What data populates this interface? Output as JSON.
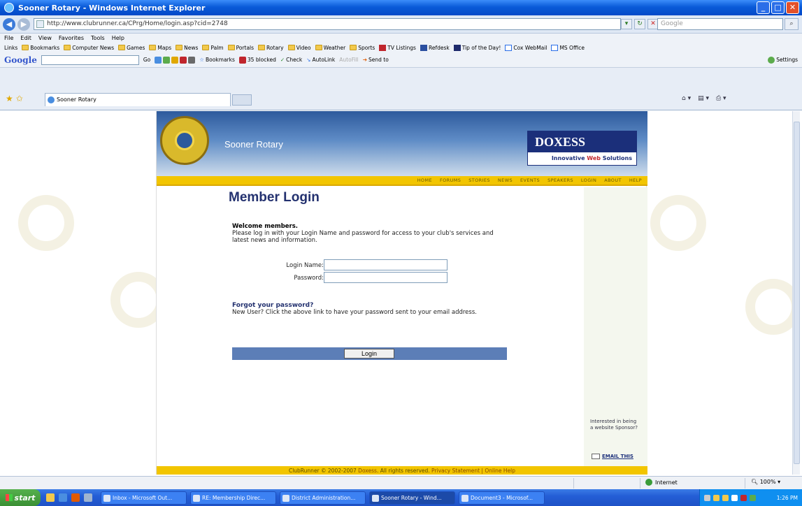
{
  "window": {
    "title": "Sooner Rotary - Windows Internet Explorer"
  },
  "address": {
    "url": "http://www.clubrunner.ca/CPrg/Home/login.asp?cid=2748",
    "search_placeholder": "Google"
  },
  "menu": [
    "File",
    "Edit",
    "View",
    "Favorites",
    "Tools",
    "Help"
  ],
  "links": {
    "label": "Links",
    "items": [
      "Bookmarks",
      "Computer News",
      "Games",
      "Maps",
      "News",
      "Palm",
      "Portals",
      "Rotary",
      "Video",
      "Weather",
      "Sports",
      "TV Listings",
      "Refdesk",
      "Tip of the Day!",
      "Cox WebMail",
      "MS Office"
    ]
  },
  "google": {
    "logo": "Google",
    "go": "Go",
    "bookmarks": "Bookmarks",
    "blocked": "35 blocked",
    "check": "Check",
    "autolink": "AutoLink",
    "autofill": "AutoFill",
    "sendto": "Send to",
    "settings": "Settings"
  },
  "tab": {
    "label": "Sooner Rotary"
  },
  "site": {
    "name": "Sooner Rotary",
    "vendor_logo": "DOXESS",
    "vendor_tag_a": "Innovative ",
    "vendor_tag_b": "Web",
    "vendor_tag_c": " Solutions",
    "nav": [
      "HOME",
      "FORUMS",
      "STORIES",
      "NEWS",
      "EVENTS",
      "SPEAKERS",
      "LOGIN",
      "ABOUT",
      "HELP"
    ],
    "heading": "Member Login",
    "welcome": "Welcome members.",
    "intro": "Please log in with your Login Name and password for access to your club's services and latest news and information.",
    "login_label": "Login Name:",
    "password_label": "Password:",
    "forgot": "Forgot your password?",
    "new_user": "New User? Click the above link to have your password sent to your email address.",
    "login_button": "Login",
    "sponsor": "Interested in being a website Sponsor?",
    "email_this": "EMAIL THIS",
    "footer_a": "ClubRunner © 2002-2007 ",
    "footer_b": "Doxess",
    "footer_c": ". All rights reserved. ",
    "footer_d": "Privacy Statement | Online Help"
  },
  "status": {
    "zone": "Internet",
    "zoom": "100%"
  },
  "taskbar": {
    "start": "start",
    "tasks": [
      "Inbox - Microsoft Out...",
      "RE: Membership Direc...",
      "District Administration...",
      "Sooner Rotary - Wind...",
      "Document3 - Microsof..."
    ],
    "active_index": 3,
    "clock": "1:26 PM"
  },
  "colors": {
    "accent": "#23316f",
    "nav_yellow": "#f2c500",
    "login_bar": "#5c7eb7"
  }
}
